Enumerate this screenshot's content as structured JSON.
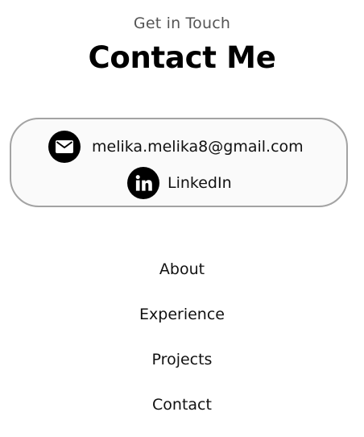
{
  "header": {
    "eyebrow": "Get in Touch",
    "title": "Contact Me"
  },
  "contact": {
    "email": {
      "icon": "email-icon",
      "label": "melika.melika8@gmail.com"
    },
    "linkedin": {
      "icon": "linkedin-icon",
      "label": "LinkedIn"
    }
  },
  "nav": {
    "items": [
      {
        "label": "About"
      },
      {
        "label": "Experience"
      },
      {
        "label": "Projects"
      },
      {
        "label": "Contact"
      }
    ]
  },
  "colors": {
    "text": "#000000",
    "muted": "#555555",
    "card_border": "#a3a3a3",
    "card_background": "#fafafa",
    "icon_background": "#000000"
  }
}
